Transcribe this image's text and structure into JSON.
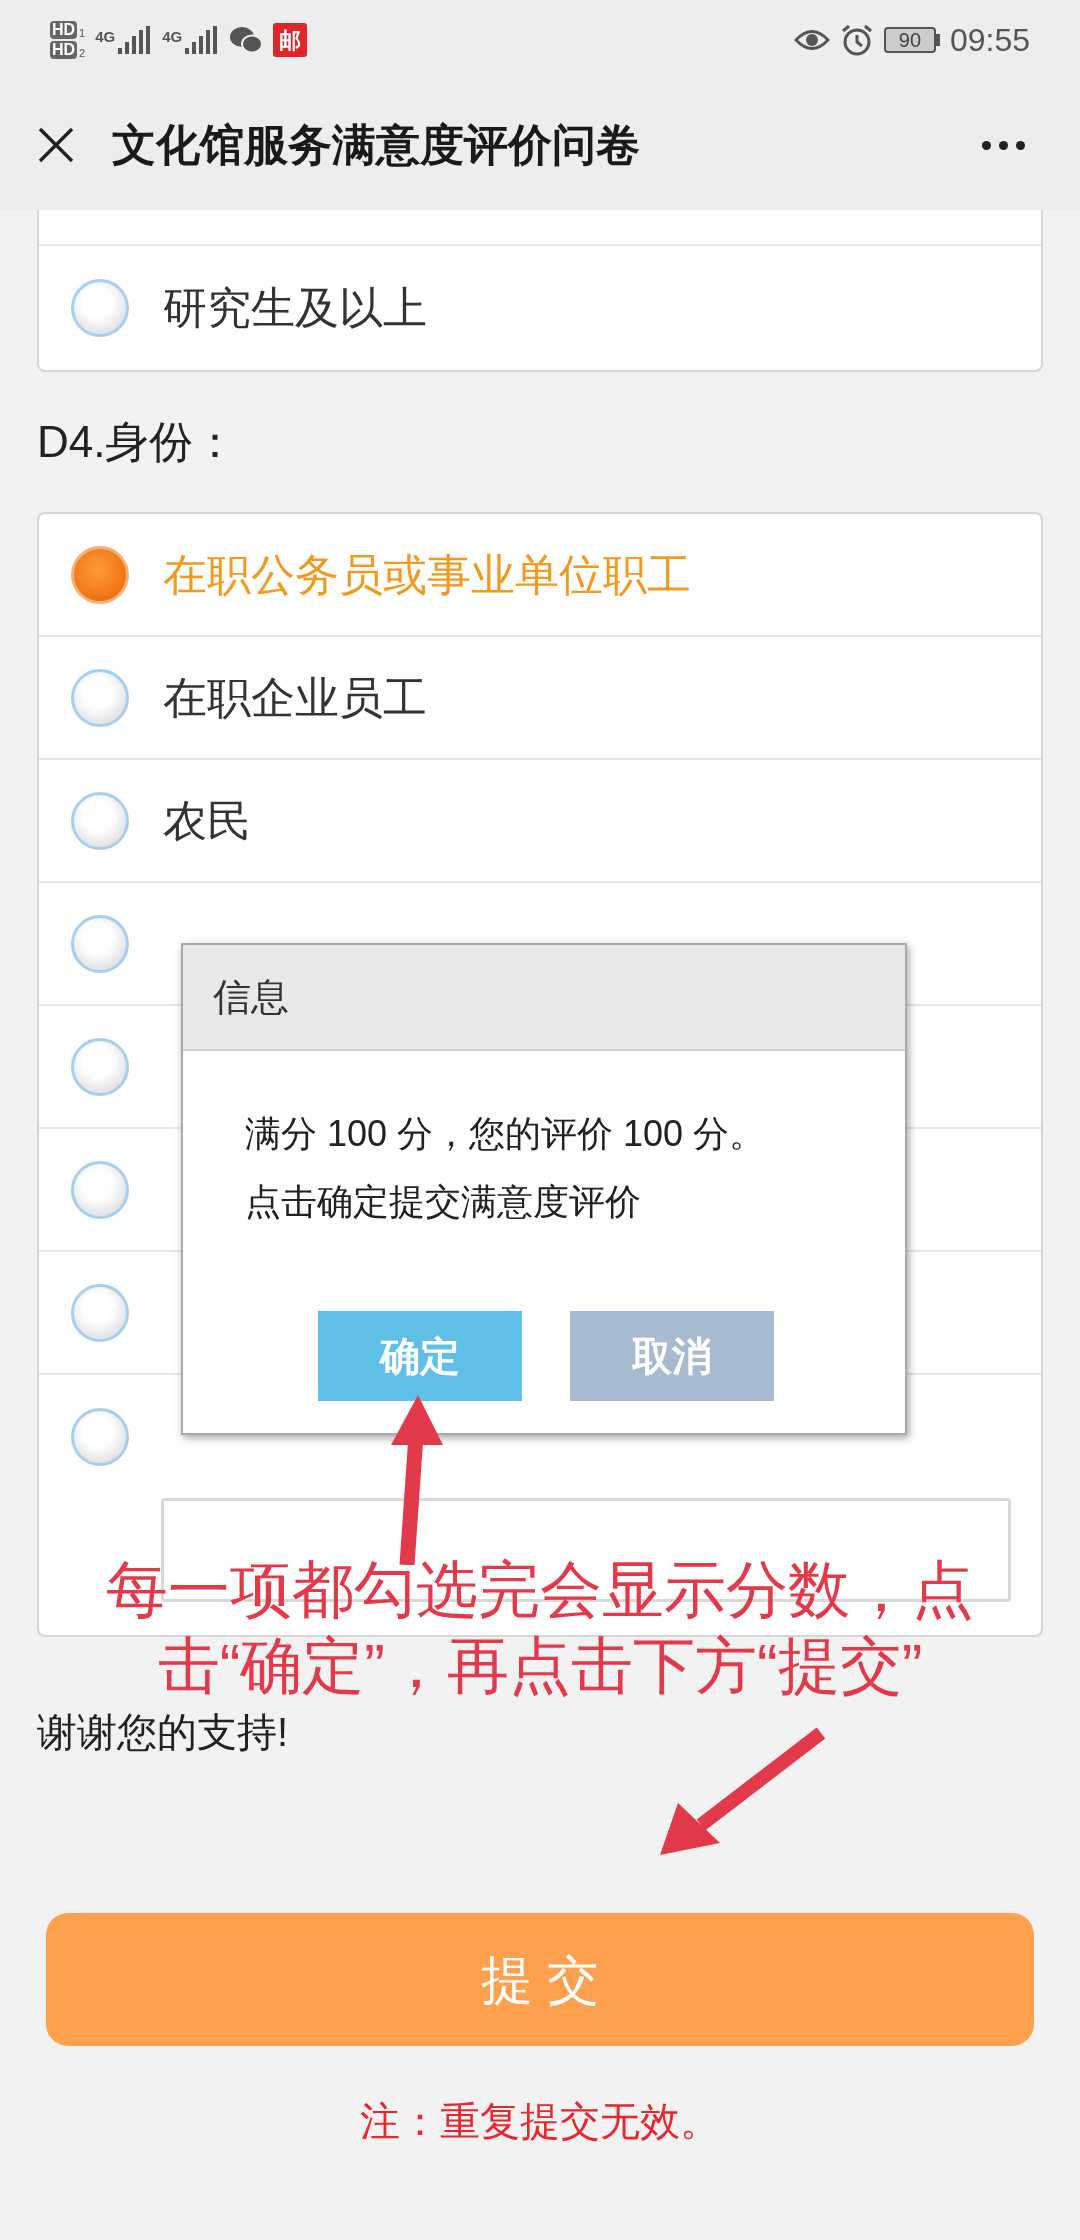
{
  "status_bar": {
    "hd": [
      {
        "label": "HD",
        "slot": "1"
      },
      {
        "label": "HD",
        "slot": "2"
      }
    ],
    "network": [
      "4G",
      "4G"
    ],
    "app_badge": "邮",
    "battery": "90",
    "time": "09:55"
  },
  "nav": {
    "title": "文化馆服务满意度评价问卷"
  },
  "previous_question": {
    "options": [
      {
        "label": "研究生及以上",
        "selected": false
      }
    ]
  },
  "question": {
    "title": "D4.身份：",
    "options": [
      {
        "label": "在职公务员或事业单位职工",
        "selected": true,
        "kind": "plain"
      },
      {
        "label": "在职企业员工",
        "selected": false,
        "kind": "plain"
      },
      {
        "label": "农民",
        "selected": false,
        "kind": "plain"
      },
      {
        "selected": false,
        "kind": "plain"
      },
      {
        "selected": false,
        "kind": "plain"
      },
      {
        "selected": false,
        "kind": "plain"
      },
      {
        "selected": false,
        "kind": "plain"
      },
      {
        "selected": false,
        "kind": "other"
      }
    ]
  },
  "footer_text": "谢谢您的支持!",
  "submit": "提 交",
  "note": "注：重复提交无效。",
  "dialog": {
    "title": "信息",
    "lines": [
      "满分 100 分，您的评价 100 分。",
      "点击确定提交满意度评价"
    ],
    "buttons": [
      {
        "label": "确定",
        "kind": "primary"
      },
      {
        "label": "取消",
        "kind": "secondary"
      }
    ]
  },
  "annotation": {
    "lines": [
      "每一项都勾选完会显示分数，点",
      "击“确定”，再点击下方“提交”"
    ]
  }
}
